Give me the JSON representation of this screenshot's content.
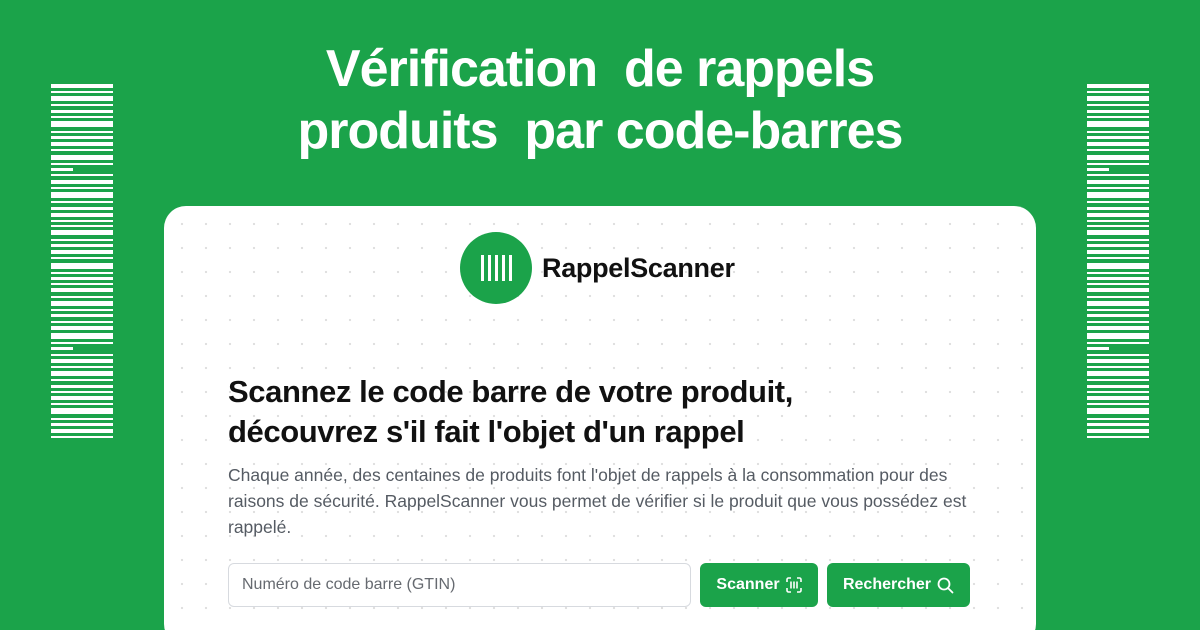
{
  "headline": {
    "line1": "Vérification  de rappels",
    "line2": "produits  par code-barres"
  },
  "brand": {
    "name": "RappelScanner",
    "logo_icon": "barcode-icon"
  },
  "hero": {
    "title_line1": "Scannez le code barre de votre produit,",
    "title_line2": "découvrez s'il fait l'objet d'un rappel",
    "description": "Chaque année, des centaines de produits font l'objet de rappels à la consommation pour des raisons de sécurité. RappelScanner vous permet de vérifier si le produit que vous possédez est rappelé."
  },
  "search": {
    "placeholder": "Numéro de code barre (GTIN)",
    "value": "",
    "scan_label": "Scanner",
    "scan_icon": "barcode-scan-icon",
    "search_label": "Rechercher",
    "search_icon": "search-icon"
  },
  "colors": {
    "brand_green": "#1ba34a",
    "card_background": "#ffffff",
    "text_dark": "#111111",
    "text_muted": "#555b63"
  }
}
